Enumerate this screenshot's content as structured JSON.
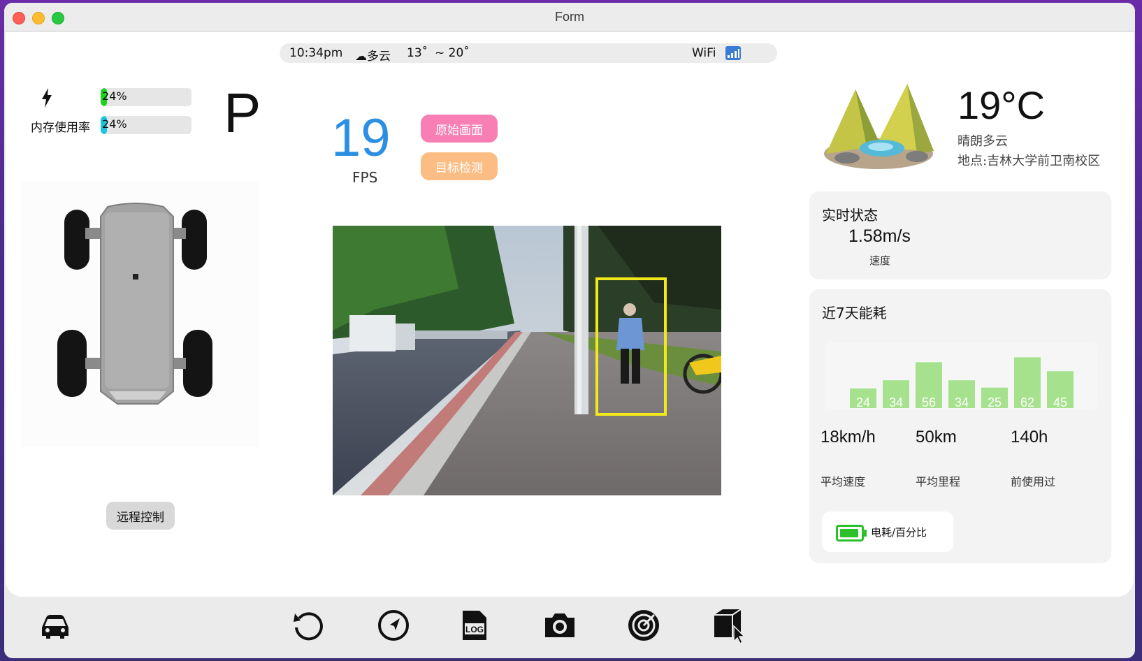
{
  "window": {
    "title": "Form"
  },
  "statusbar": {
    "time": "10:34pm",
    "weather": "☁多云",
    "temp_low": "13˚",
    "temp_high": "~ 20˚",
    "wifi": "WiFi"
  },
  "system": {
    "battery_percent_text": "24%",
    "battery_fraction": 0.24,
    "memory_label": "内存使用率",
    "memory_percent_text": "24%",
    "memory_fraction": 0.24,
    "gear": "P"
  },
  "vehicle": {
    "remote_control_label": "远程控制"
  },
  "video": {
    "fps_value": "19",
    "fps_label": "FPS",
    "btn_original": "原始画面",
    "btn_detection": "目标检测"
  },
  "weather": {
    "temperature": "19°C",
    "condition": "晴朗多云",
    "location": "地点:吉林大学前卫南校区"
  },
  "realtime": {
    "title": "实时状态",
    "speed": "1.58m/s",
    "speed_label": "速度"
  },
  "energy": {
    "title": "近7天能耗",
    "avg_speed": "18km/h",
    "avg_speed_label": "平均速度",
    "avg_distance": "50km",
    "avg_distance_label": "平均里程",
    "used": "140h",
    "used_label": "前使用过",
    "battery_label": "电耗/百分比"
  },
  "chart_data": {
    "type": "bar",
    "title": "近7天能耗",
    "values": [
      24,
      34,
      56,
      34,
      25,
      62,
      45
    ],
    "bar_color": "#a6e28e"
  },
  "toolbar": {
    "items": [
      "car-icon",
      "refresh-icon",
      "navigation-icon",
      "log-file-icon",
      "camera-icon",
      "radar-icon",
      "box-cursor-icon"
    ]
  },
  "colors": {
    "fps": "#2b8fe3",
    "btn_original": "#f77fb4",
    "btn_detection": "#fbbd84",
    "battery_fill": "#1fd21f",
    "memory_fill": "#1ec3dd",
    "detection_box": "#f3e81a"
  }
}
